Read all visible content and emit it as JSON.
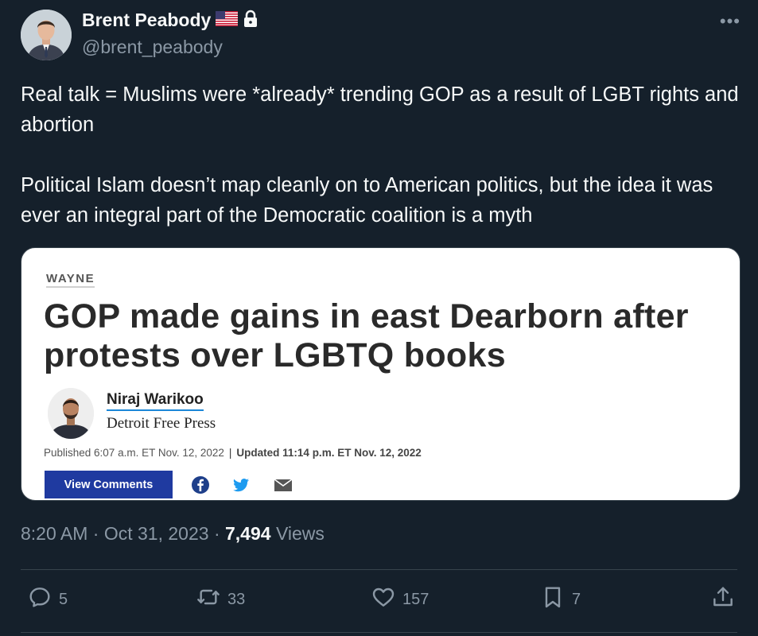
{
  "author": {
    "name": "Brent Peabody",
    "handle": "@brent_peabody",
    "badges": [
      "us-flag-icon",
      "lock-icon"
    ]
  },
  "tweet": {
    "paragraphs": [
      "Real talk = Muslims were *already* trending GOP as a result of LGBT rights and abortion",
      "Political Islam doesn’t map cleanly on to American politics, but the idea it was ever an integral part of the Democratic coalition is a myth"
    ]
  },
  "card": {
    "section": "WAYNE",
    "headline": "GOP made gains in east Dearborn after protests over LGBTQ books",
    "author_name": "Niraj Warikoo",
    "outlet": "Detroit Free Press",
    "published": "Published 6:07 a.m. ET Nov. 12, 2022",
    "updated": "Updated 11:14 p.m. ET Nov. 12, 2022",
    "view_comments": "View Comments",
    "share_icons": [
      "facebook-icon",
      "twitter-icon",
      "mail-icon"
    ]
  },
  "meta": {
    "time": "8:20 AM",
    "date": "Oct 31, 2023",
    "views_count": "7,494",
    "views_label": "Views"
  },
  "actions": {
    "replies": "5",
    "retweets": "33",
    "likes": "157",
    "bookmarks": "7"
  },
  "colors": {
    "background": "#15202b",
    "text": "#f7f9f9",
    "secondary": "#8b98a5",
    "button": "#1f3aa0"
  }
}
